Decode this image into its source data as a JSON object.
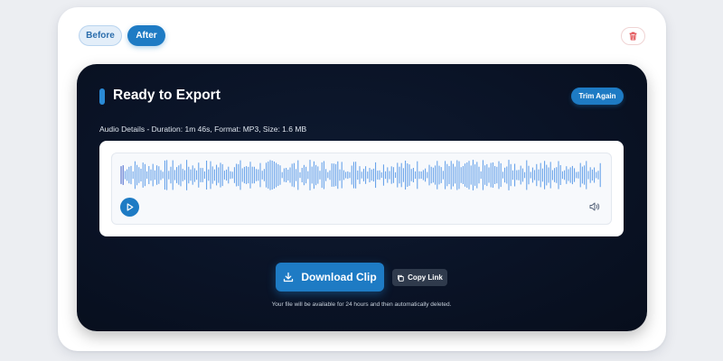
{
  "view_toggle": {
    "before_label": "Before",
    "after_label": "After",
    "active": "After"
  },
  "export": {
    "title": "Ready to Export",
    "trim_again_label": "Trim Again",
    "details": "Audio Details - Duration: 1m 46s, Format: MP3, Size: 1.6 MB"
  },
  "player": {
    "play_icon": "play-icon",
    "volume_icon": "volume-icon",
    "waveform_color": "#5b9be8",
    "progress_color": "#3f5fc9",
    "progress": 0.0
  },
  "actions": {
    "download_label": "Download Clip",
    "download_icon": "download-icon",
    "copy_link_label": "Copy Link",
    "copy_icon": "copy-icon",
    "delete_icon": "trash-icon"
  },
  "note": "Your file will be available for 24 hours and then automatically deleted.",
  "colors": {
    "accent": "#1e7bc4",
    "panel_dark": "#0a1326",
    "delete": "#e0474c"
  }
}
